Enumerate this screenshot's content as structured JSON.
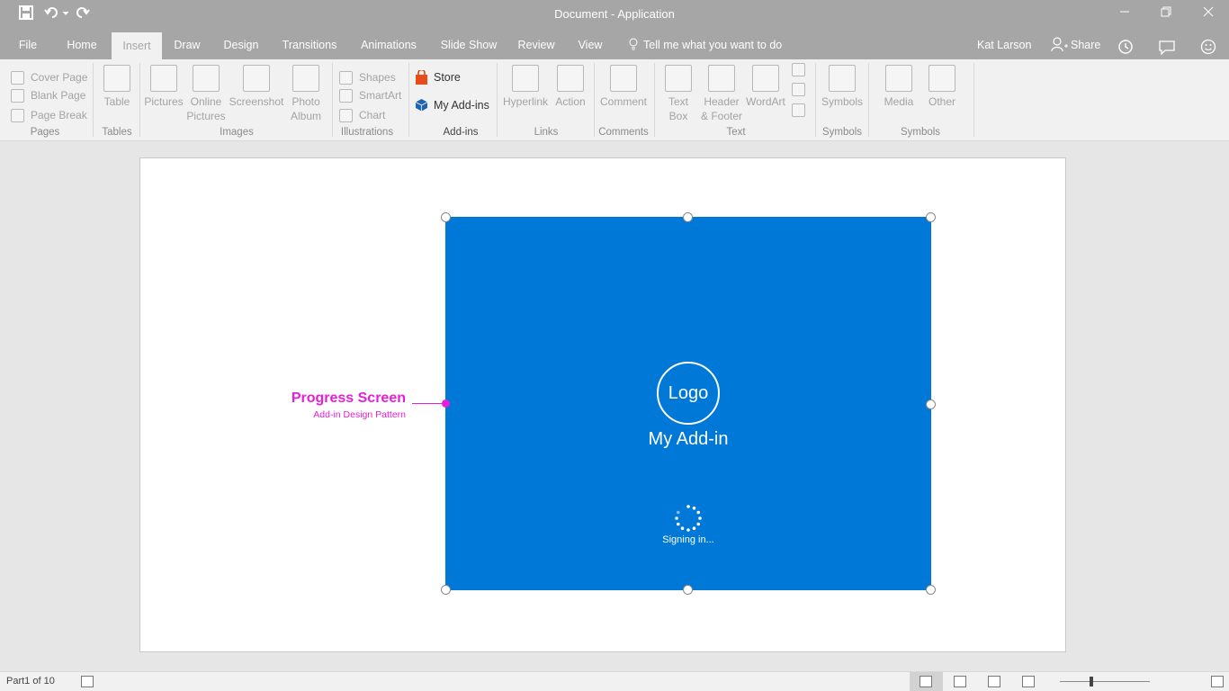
{
  "window": {
    "title": "Document - Application",
    "icons": [
      "save-icon",
      "undo-icon",
      "redo-icon",
      "minimize-icon",
      "restore-icon",
      "close-icon"
    ]
  },
  "tabs": {
    "items": [
      "File",
      "Home",
      "Insert",
      "Draw",
      "Design",
      "Transitions",
      "Animations",
      "Slide Show",
      "Review",
      "View"
    ],
    "active": "Insert",
    "tell_me": "Tell me what you want to do",
    "user": "Kat Larson",
    "share": "Share"
  },
  "ribbon": {
    "pages": {
      "items": [
        "Cover Page",
        "Blank Page",
        "Page Break"
      ],
      "group": "Pages"
    },
    "tables": {
      "button": "Table",
      "group": "Tables"
    },
    "images": {
      "b1": "Pictures",
      "b2a": "Online",
      "b2b": "Pictures",
      "b3": "Screenshot",
      "b4a": "Photo",
      "b4b": "Album",
      "group": "Images"
    },
    "illustrations": {
      "items": [
        "Shapes",
        "SmartArt",
        "Chart"
      ],
      "group": "Illustrations"
    },
    "addins": {
      "store": "Store",
      "my_addins": "My Add-ins",
      "group": "Add-ins"
    },
    "links": {
      "b1": "Hyperlink",
      "b2": "Action",
      "group": "Links"
    },
    "comments": {
      "b1": "Comment",
      "group": "Comments"
    },
    "text": {
      "b1a": "Text",
      "b1b": "Box",
      "b2a": "Header",
      "b2b": "& Footer",
      "b3": "WordArt",
      "group": "Text"
    },
    "symbols": {
      "b1": "Symbols",
      "group": "Symbols"
    },
    "media": {
      "b1": "Media",
      "b2": "Other",
      "group": "Symbols"
    }
  },
  "slide": {
    "logo": "Logo",
    "addin_name": "My Add-in",
    "status": "Signing in...",
    "annotation_title": "Progress Screen",
    "annotation_subtitle": "Add-in Design Pattern",
    "panel_color": "#0078d7",
    "annotation_color": "#e51fd8"
  },
  "statusbar": {
    "page": "Part1 of 10"
  }
}
